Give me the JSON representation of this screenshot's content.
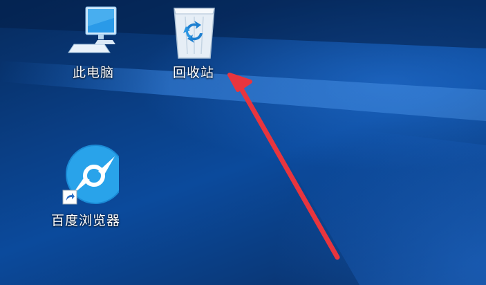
{
  "desktop": {
    "icons": [
      {
        "id": "computer",
        "label": "此电脑",
        "icon": "computer-icon"
      },
      {
        "id": "recycle",
        "label": "回收站",
        "icon": "recycle-bin-icon"
      },
      {
        "id": "browser",
        "label": "百度浏览器",
        "icon": "baidu-browser-icon",
        "shortcut": true
      }
    ]
  },
  "annotation": {
    "arrow_color": "#e8353e",
    "points_to": "回收站"
  },
  "colors": {
    "wallpaper_dark": "#062a5c",
    "wallpaper_light": "#0b4a9c",
    "browser_icon_blue": "#2aa7ea"
  }
}
